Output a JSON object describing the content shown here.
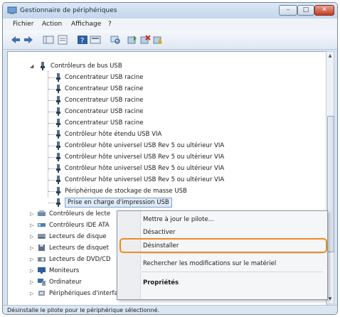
{
  "window": {
    "title": "Gestionnaire de périphériques"
  },
  "menu": [
    "Fichier",
    "Action",
    "Affichage",
    "?"
  ],
  "tree": {
    "usb_root": "Contrôleurs de bus USB",
    "usb_children": [
      "Concentrateur USB racine",
      "Concentrateur USB racine",
      "Concentrateur USB racine",
      "Concentrateur USB racine",
      "Concentrateur USB racine",
      "Contrôleur hôte étendu USB VIA",
      "Contrôleur hôte universel USB Rev 5 ou ultérieur VIA",
      "Contrôleur hôte universel USB Rev 5 ou ultérieur VIA",
      "Contrôleur hôte universel USB Rev 5 ou ultérieur VIA",
      "Contrôleur hôte universel USB Rev 5 ou ultérieur VIA",
      "Périphérique de stockage de masse USB",
      "Prise en charge d'impression USB"
    ],
    "other_categories": [
      "Contrôleurs de lecte",
      "Contrôleurs IDE ATA",
      "Lecteurs de disque",
      "Lecteurs de disquet",
      "Lecteurs de DVD/CD",
      "Moniteurs",
      "Ordinateur",
      "Périphériques d'interface utilisateur"
    ]
  },
  "context_menu": {
    "update": "Mettre à jour le pilote...",
    "disable": "Désactiver",
    "uninstall": "Désinstaller",
    "scan": "Rechercher les modifications sur le matériel",
    "properties": "Propriétés"
  },
  "status": "Désinstalle le pilote pour le périphérique sélectionné.",
  "colors": {
    "highlight_outline": "#f08a1c",
    "selection": "#dfeaf7"
  }
}
